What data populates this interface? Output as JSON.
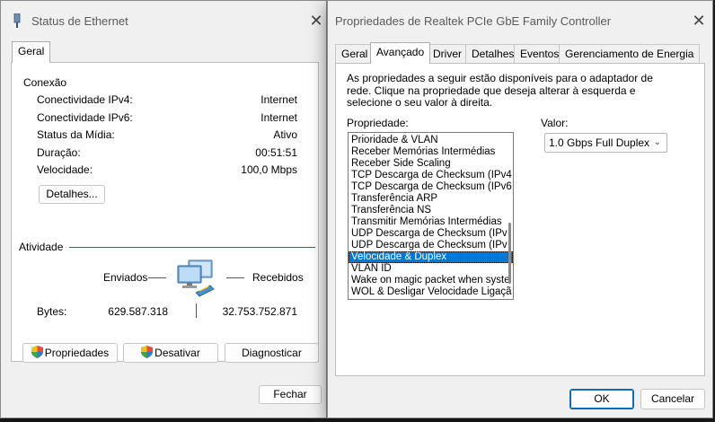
{
  "left": {
    "title": "Status de Ethernet",
    "tab": "Geral",
    "conexao": {
      "heading": "Conexão",
      "rows": [
        {
          "label": "Conectividade IPv4:",
          "value": "Internet"
        },
        {
          "label": "Conectividade IPv6:",
          "value": "Internet"
        },
        {
          "label": "Status da Mídia:",
          "value": "Ativo"
        },
        {
          "label": "Duração:",
          "value": "00:51:51"
        },
        {
          "label": "Velocidade:",
          "value": "100,0 Mbps"
        }
      ],
      "details_button": "Detalhes..."
    },
    "atividade": {
      "heading": "Atividade",
      "sent_label": "Enviados",
      "received_label": "Recebidos",
      "bytes_label": "Bytes:",
      "bytes_sent": "629.587.318",
      "bytes_received": "32.753.752.871"
    },
    "buttons": {
      "properties": "Propriedades",
      "disable": "Desativar",
      "diagnose": "Diagnosticar",
      "close": "Fechar"
    }
  },
  "right": {
    "title": "Propriedades de Realtek PCIe GbE Family Controller",
    "tabs": [
      "Geral",
      "Avançado",
      "Driver",
      "Detalhes",
      "Eventos",
      "Gerenciamento de Energia"
    ],
    "active_tab": "Avançado",
    "description": [
      "As propriedades a seguir estão disponíveis para o adaptador de",
      "rede. Clique na propriedade que deseja alterar à esquerda e",
      "selecione o seu valor à direita."
    ],
    "property_label": "Propriedade:",
    "value_label": "Valor:",
    "properties": [
      "Prioridade & VLAN",
      "Receber Memórias Intermédias",
      "Receber Side Scaling",
      "TCP Descarga de Checksum (IPv4",
      "TCP Descarga de Checksum (IPv6",
      "Transferência ARP",
      "Transferência NS",
      "Transmitir Memórias Intermédias",
      "UDP Descarga de Checksum (IPv",
      "UDP Descarga de Checksum (IPv",
      "Velocidade & Duplex",
      "VLAN ID",
      "Wake on magic packet when syste",
      "WOL & Desligar Velocidade Ligaçã"
    ],
    "selected_property": "Velocidade & Duplex",
    "value_selected": "1.0 Gbps Full Duplex",
    "ok": "OK",
    "cancel": "Cancelar"
  }
}
